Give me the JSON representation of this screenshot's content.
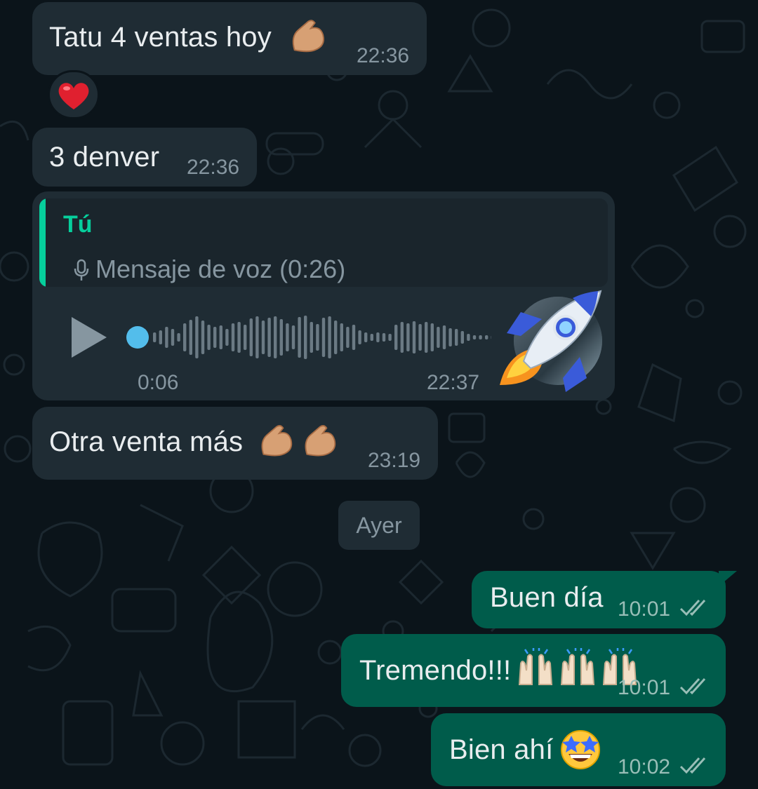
{
  "conversation": {
    "messages": [
      {
        "direction": "incoming",
        "text": "Tatu 4 ventas hoy",
        "emojis": [
          "flexed-biceps"
        ],
        "time": "22:36",
        "reaction": "red-heart"
      },
      {
        "direction": "incoming",
        "text": "3 denver",
        "time": "22:36"
      },
      {
        "direction": "incoming",
        "type": "voice-reply",
        "quote": {
          "author": "Tú",
          "text": "Mensaje de voz (0:26)",
          "icon": "microphone-icon"
        },
        "elapsed": "0:06",
        "time": "22:37",
        "progress": 0.02,
        "sticker": "rocket"
      },
      {
        "direction": "incoming",
        "text": "Otra venta más",
        "emojis": [
          "flexed-biceps",
          "flexed-biceps"
        ],
        "time": "23:19"
      },
      {
        "direction": "outgoing",
        "text": "Buen día",
        "time": "10:01",
        "status": "read"
      },
      {
        "direction": "outgoing",
        "text": "Tremendo!!!",
        "emojis": [
          "raising-hands",
          "raising-hands",
          "raising-hands"
        ],
        "time": "10:01",
        "status": "read"
      },
      {
        "direction": "outgoing",
        "text": "Bien ahí",
        "emojis": [
          "star-struck"
        ],
        "time": "10:02",
        "status": "read"
      }
    ],
    "date_separator": "Ayer"
  },
  "colors": {
    "background": "#0b141a",
    "incoming_bubble": "#1f2c34",
    "outgoing_bubble": "#005c4b",
    "accent": "#06cf9c",
    "voice_progress": "#53bdeb"
  }
}
